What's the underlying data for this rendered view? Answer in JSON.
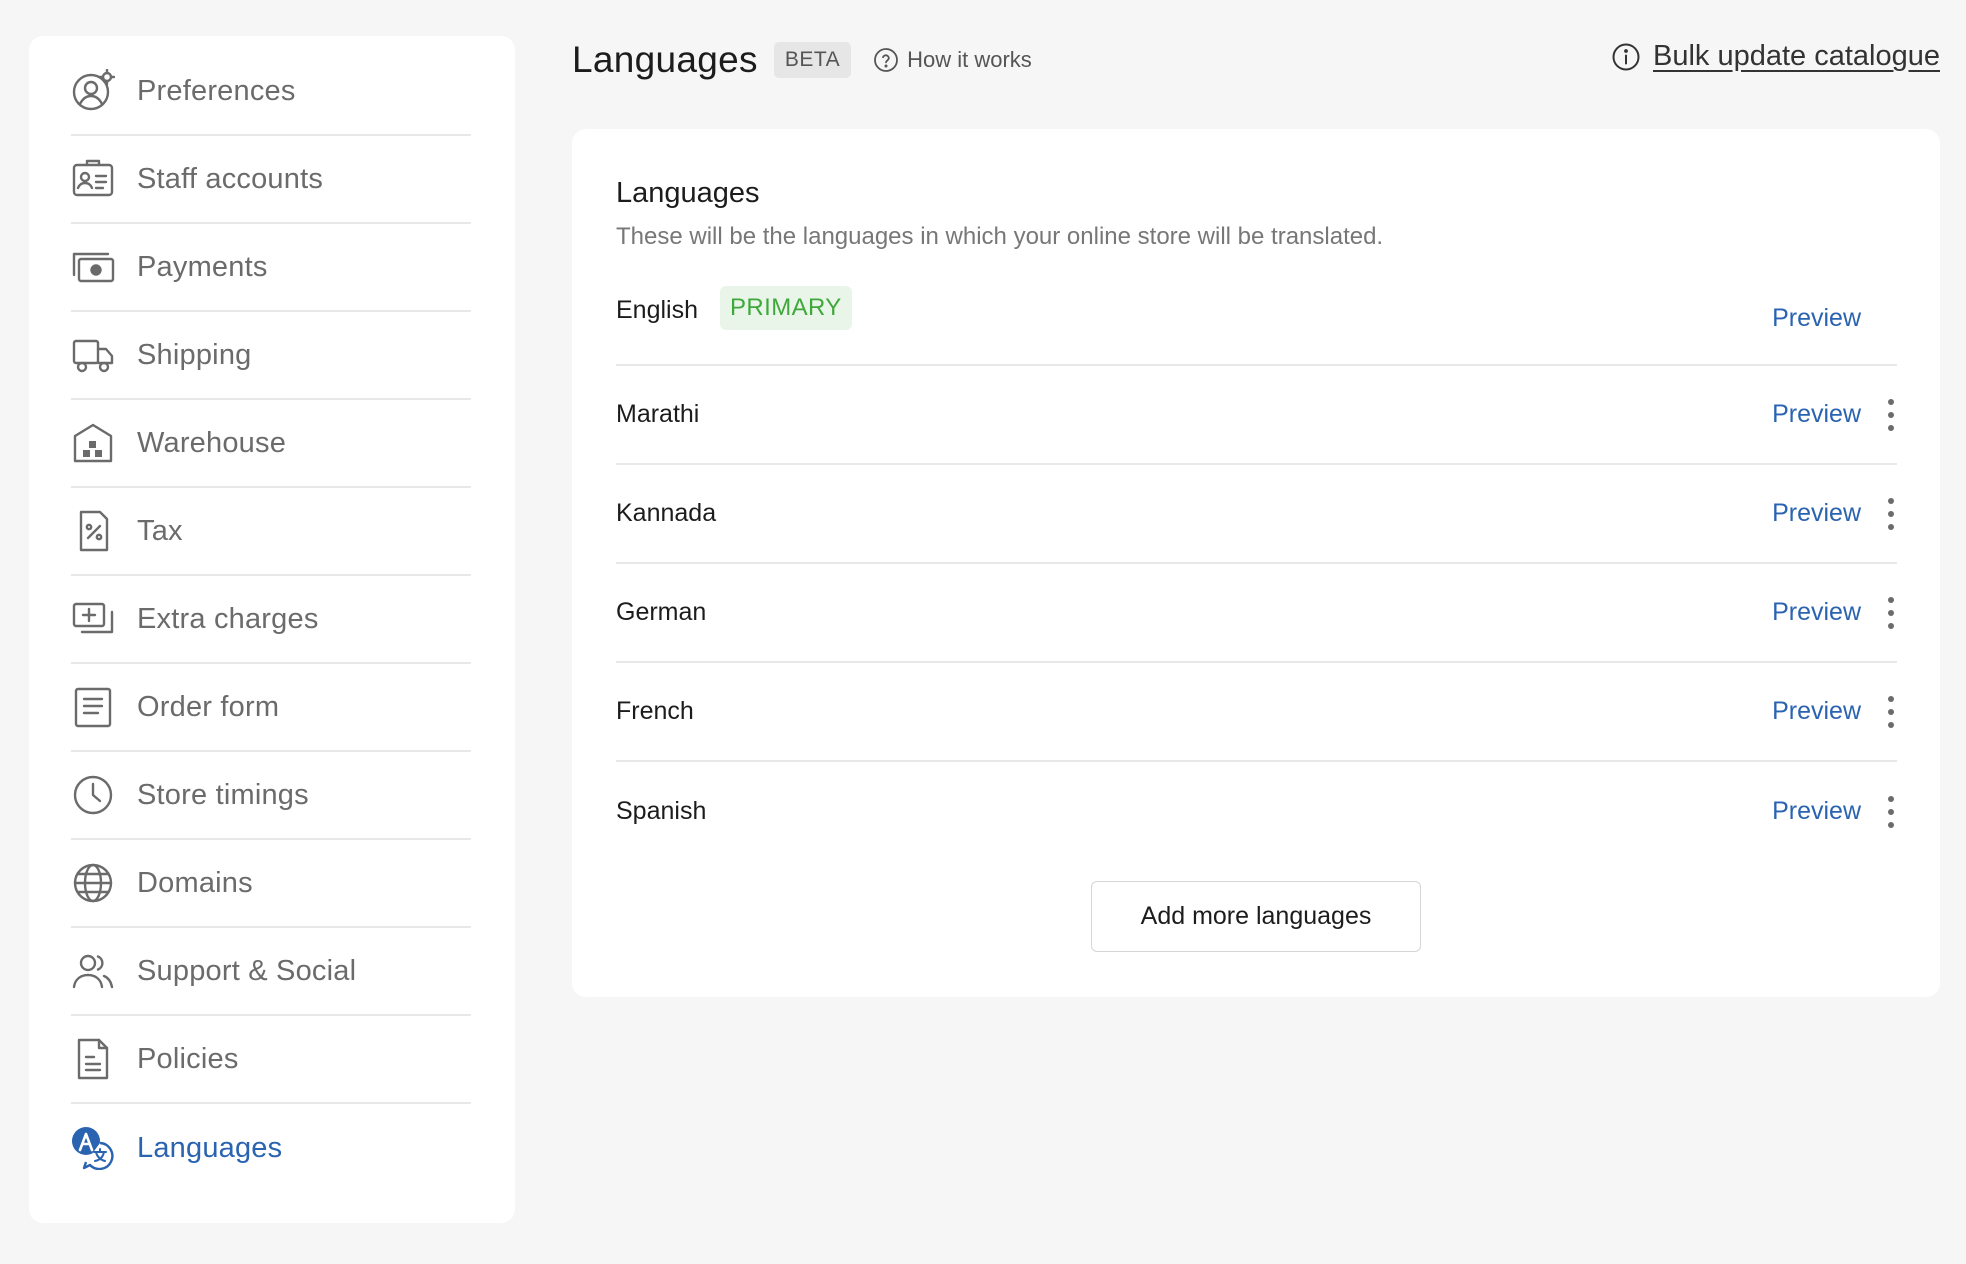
{
  "sidebar": {
    "items": [
      {
        "label": "Preferences",
        "icon": "user-settings-icon",
        "active": false
      },
      {
        "label": "Staff accounts",
        "icon": "id-card-icon",
        "active": false
      },
      {
        "label": "Payments",
        "icon": "cash-icon",
        "active": false
      },
      {
        "label": "Shipping",
        "icon": "truck-icon",
        "active": false
      },
      {
        "label": "Warehouse",
        "icon": "warehouse-icon",
        "active": false
      },
      {
        "label": "Tax",
        "icon": "percent-document-icon",
        "active": false
      },
      {
        "label": "Extra charges",
        "icon": "add-charges-icon",
        "active": false
      },
      {
        "label": "Order form",
        "icon": "form-icon",
        "active": false
      },
      {
        "label": "Store timings",
        "icon": "clock-icon",
        "active": false
      },
      {
        "label": "Domains",
        "icon": "globe-icon",
        "active": false
      },
      {
        "label": "Support & Social",
        "icon": "users-icon",
        "active": false
      },
      {
        "label": "Policies",
        "icon": "document-icon",
        "active": false
      },
      {
        "label": "Languages",
        "icon": "translate-icon",
        "active": true
      }
    ]
  },
  "header": {
    "title": "Languages",
    "badge": "BETA",
    "how_it_works": "How it works",
    "bulk_update": "Bulk update catalogue"
  },
  "card": {
    "title": "Languages",
    "description": "These will be the languages in which your online store will be translated.",
    "primary_badge": "PRIMARY",
    "preview_label": "Preview",
    "languages": [
      {
        "name": "English",
        "primary": true
      },
      {
        "name": "Marathi",
        "primary": false
      },
      {
        "name": "Kannada",
        "primary": false
      },
      {
        "name": "German",
        "primary": false
      },
      {
        "name": "French",
        "primary": false
      },
      {
        "name": "Spanish",
        "primary": false
      }
    ],
    "add_button": "Add more languages"
  },
  "colors": {
    "accent": "#2a63b0",
    "primary_badge_text": "#3fa83b",
    "primary_badge_bg": "#eaf5ea",
    "background": "#f6f6f6"
  }
}
